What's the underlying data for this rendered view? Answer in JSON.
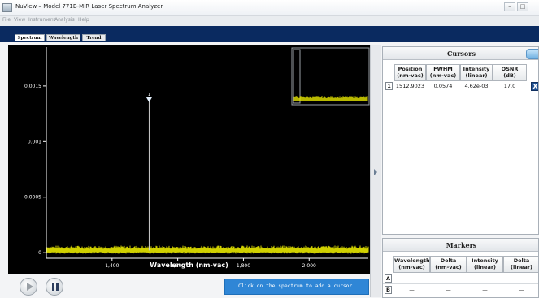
{
  "window": {
    "title": "NuView – Model 771B-MIR Laser Spectrum Analyzer"
  },
  "menu": [
    "File",
    "View",
    "Instrument",
    "Analysis",
    "Help"
  ],
  "tabs": [
    {
      "label": "Spectrum",
      "active": true
    },
    {
      "label": "Wavelength",
      "active": false
    },
    {
      "label": "Trend",
      "active": false
    }
  ],
  "chart_data": {
    "type": "line",
    "xlabel": "Wavelength (nm-vac)",
    "ylabel": "",
    "xlim": [
      1200,
      2180
    ],
    "ylim": [
      -5e-05,
      0.00185
    ],
    "x_ticks": [
      1400,
      1600,
      1800,
      2000
    ],
    "x_tick_labels": [
      "1,400",
      "1,600",
      "1,800",
      "2,000"
    ],
    "y_ticks": [
      0,
      0.0005,
      0.001,
      0.0015
    ],
    "y_tick_labels": [
      "0",
      "0.0005",
      "0.001",
      "0.0015"
    ],
    "noise_floor": 2e-05,
    "series": [
      {
        "type": "peak",
        "x": 1512.9023,
        "y": 0.00136,
        "color": "#cfcfcf"
      }
    ],
    "noise_color": "#e8e800",
    "cursor_marker": {
      "label": "1",
      "x": 1512.9023,
      "y": 0.00136
    },
    "grid": false
  },
  "hint": "Click on the spectrum to add a cursor.",
  "cursors": {
    "title": "Cursors",
    "columns": [
      [
        "Position",
        "(nm-vac)"
      ],
      [
        "FWHM",
        "(nm-vac)"
      ],
      [
        "Intensity",
        "(linear)"
      ],
      [
        "OSNR",
        "(dB)"
      ]
    ],
    "rows": [
      {
        "index": "1",
        "position": "1512.9023",
        "fwhm": "0.0574",
        "intensity": "4.62e-03",
        "osnr": "17.0",
        "delete": "X"
      }
    ]
  },
  "markers": {
    "title": "Markers",
    "columns": [
      [
        "Wavelength",
        "(nm-vac)"
      ],
      [
        "Delta",
        "(nm-vac)"
      ],
      [
        "Intensity",
        "(linear)"
      ],
      [
        "Delta",
        "(linear)"
      ]
    ],
    "rows": [
      {
        "label": "A",
        "values": [
          "—",
          "—",
          "—",
          "—"
        ]
      },
      {
        "label": "B",
        "values": [
          "—",
          "—",
          "—",
          "—"
        ]
      }
    ]
  },
  "colors": {
    "tabstrip": "#0a2a60",
    "plot_bg": "#000000",
    "noise": "#e8e800",
    "hint_bg": "#2f86d6"
  }
}
